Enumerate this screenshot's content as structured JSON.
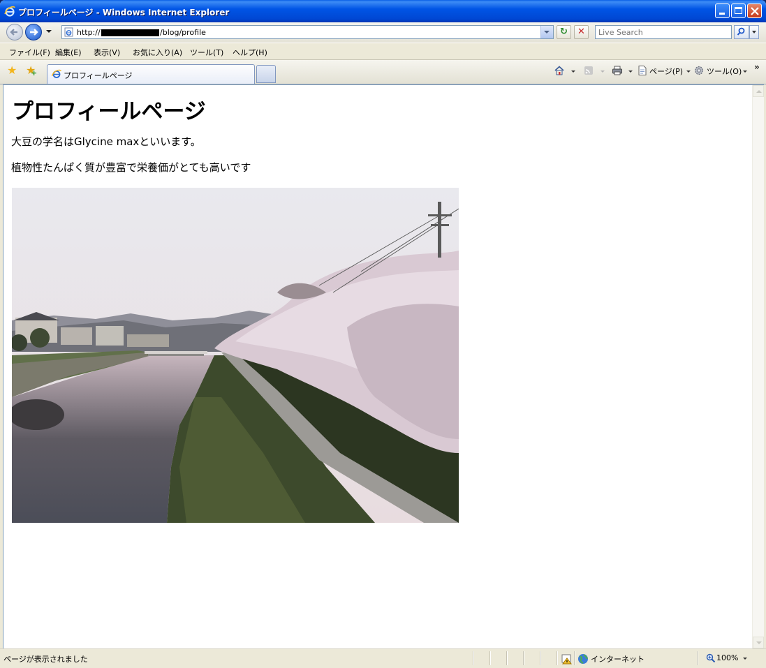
{
  "window": {
    "title": "プロフィールページ - Windows Internet Explorer"
  },
  "addressbar": {
    "url_prefix": "http://",
    "url_suffix": "/blog/profile",
    "search_placeholder": "Live Search"
  },
  "menu": {
    "items": [
      "ファイル(F)",
      "編集(E)",
      "表示(V)",
      "お気に入り(A)",
      "ツール(T)",
      "ヘルプ(H)"
    ]
  },
  "tabs": {
    "active_label": "プロフィールページ"
  },
  "commandbar": {
    "page_label": "ページ(P)",
    "tools_label": "ツール(O)"
  },
  "content": {
    "heading": "プロフィールページ",
    "paragraph1": "大豆の学名はGlycine maxといいます。",
    "paragraph2": "植物性たんぱく質が豊富で栄養価がとても高いです"
  },
  "statusbar": {
    "message": "ページが表示されました",
    "zone": "インターネット",
    "zoom": "100%"
  },
  "colors": {
    "titlebar": "#0054e3",
    "chrome": "#ece9d8",
    "close_button": "#c5391a"
  }
}
